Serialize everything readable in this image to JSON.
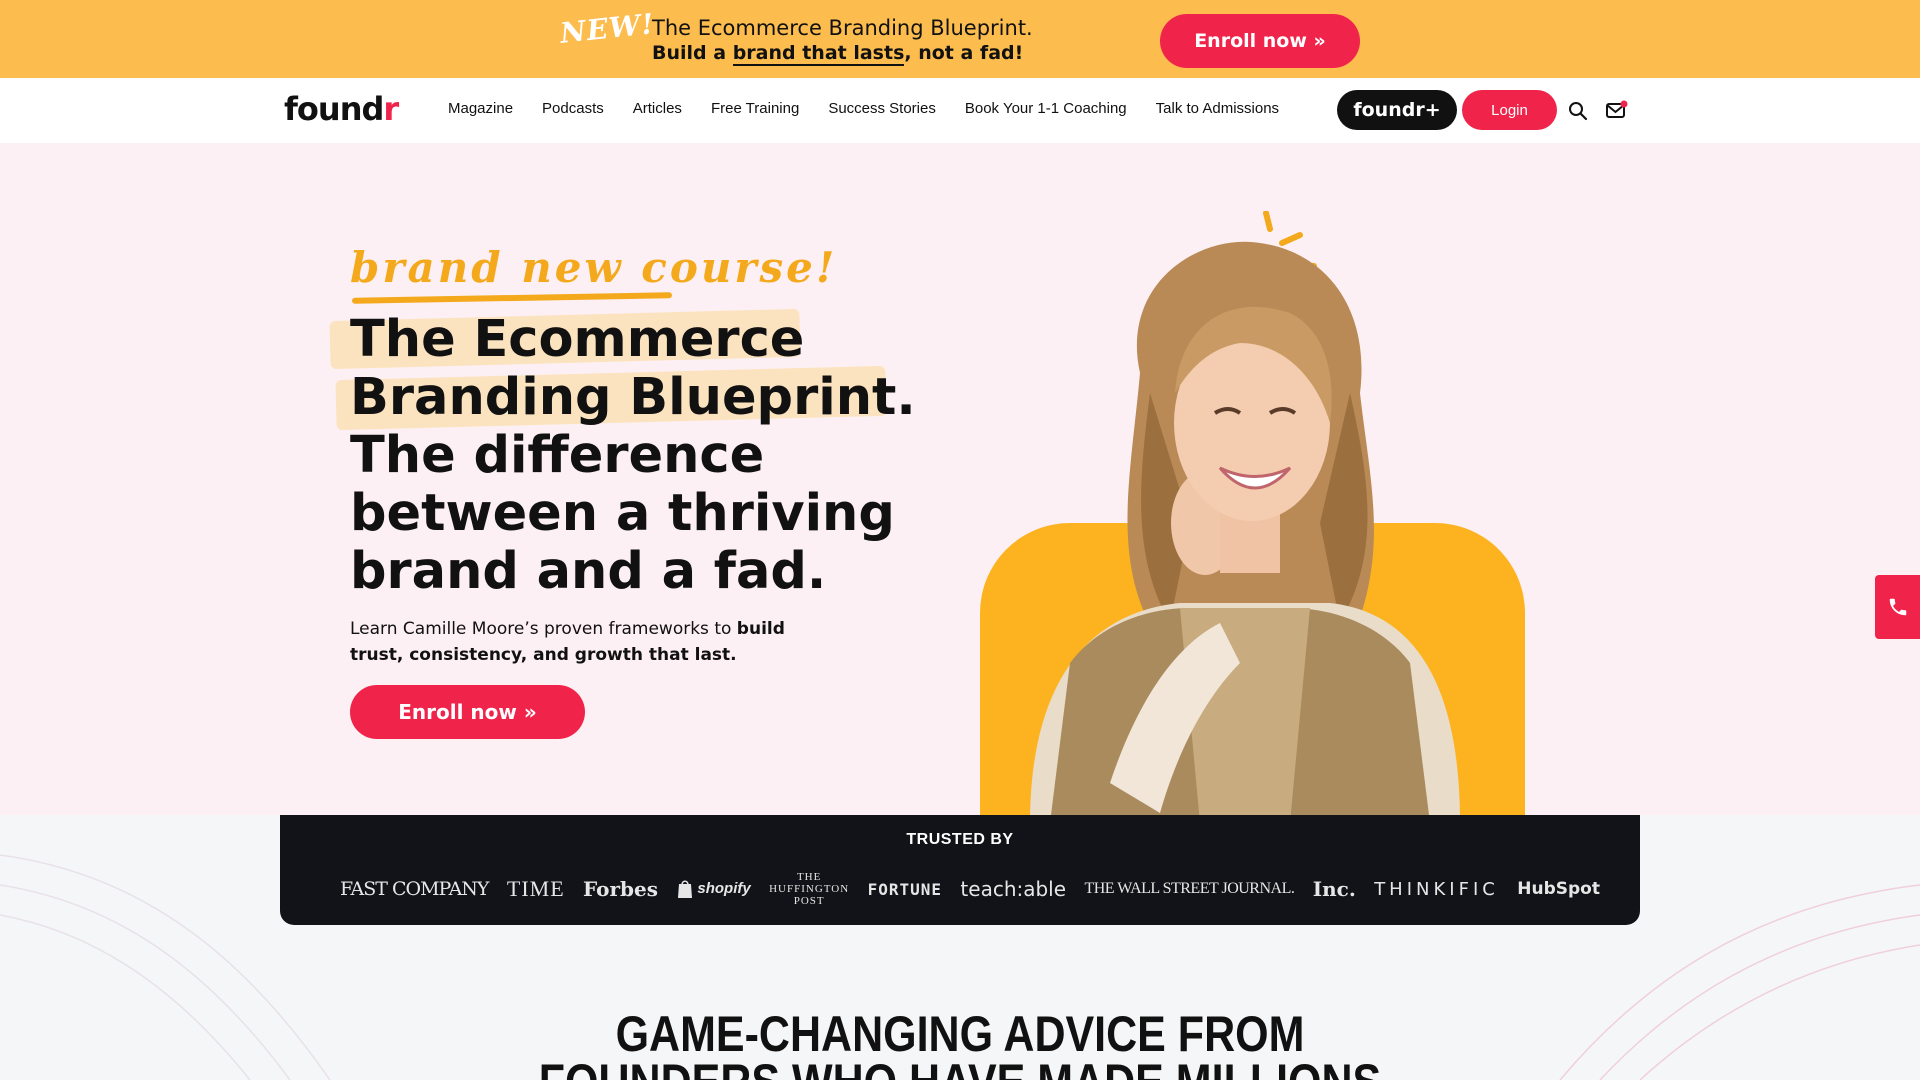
{
  "promo": {
    "new_badge": "NEW!",
    "line1": "The Ecommerce Branding Blueprint.",
    "line2_pre": "Build a ",
    "line2_ul": "brand that lasts",
    "line2_post": ", not a fad!",
    "enroll_label": "Enroll now »"
  },
  "nav": {
    "logo_main": "found",
    "logo_accent": "r",
    "links": [
      "Magazine",
      "Podcasts",
      "Articles",
      "Free Training",
      "Success Stories",
      "Book Your 1-1 Coaching",
      "Talk to Admissions"
    ],
    "foundr_plus": "foundr+",
    "login": "Login"
  },
  "hero": {
    "tagline": "brand new course!",
    "headline": [
      "The Ecommerce",
      "Branding Blueprint.",
      "The difference",
      "between a thriving",
      "brand and a fad."
    ],
    "sub_pre": "Learn Camille Moore’s proven frameworks to ",
    "sub_bold": "build trust, consistency, and growth that last.",
    "button": "Enroll now »"
  },
  "trusted": {
    "title": "TRUSTED BY",
    "logos": {
      "fastcompany": "FAST COMPANY",
      "time": "TIME",
      "forbes": "Forbes",
      "shopify": "shopify",
      "huffington": [
        "THE",
        "HUFFINGTON",
        "POST"
      ],
      "fortune": "FORTUNE",
      "teachable": "teach:able",
      "wsj": "THE WALL STREET JOURNAL.",
      "inc": "Inc.",
      "thinkific": "THINKIFIC",
      "hubspot": "HubSpot"
    }
  },
  "section": {
    "heading_line1": "GAME-CHANGING ADVICE FROM",
    "heading_line2": "FOUNDERS WHO HAVE MADE MILLIONS"
  },
  "colors": {
    "promo_bg": "#fdbc4e",
    "accent_red": "#f0234b",
    "hero_bg": "#fdf0f4",
    "arch_yellow": "#fdb21f",
    "tagline_orange": "#f4a91c",
    "trusted_bg": "#111318"
  },
  "icons": [
    "search-icon",
    "mail-icon",
    "phone-icon",
    "shopify-bag-icon"
  ]
}
